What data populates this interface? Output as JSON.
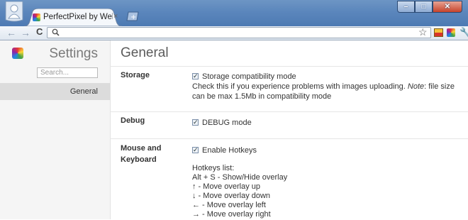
{
  "browser": {
    "tab": {
      "title": "PerfectPixel by WellDoneCode",
      "close": "×"
    },
    "window_controls": {
      "minimize": "–",
      "maximize": "□",
      "close": "✕"
    },
    "nav": {
      "back": "←",
      "forward": "→",
      "reload": "C"
    },
    "icons": {
      "profile": "profile-icon",
      "search": "search-icon",
      "star": "star-icon",
      "wrench": "wrench-icon"
    }
  },
  "sidebar": {
    "title": "Settings",
    "search_placeholder": "Search...",
    "items": [
      {
        "label": "General"
      }
    ]
  },
  "main": {
    "title": "General",
    "sections": [
      {
        "label": "Storage",
        "option": {
          "label": "Storage compatibility mode",
          "checked": true
        },
        "desc_pre": "Check this if you experience problems with images uploading. ",
        "desc_note": "Note",
        "desc_post": ": file size can be max 1.5Mb in compatibility mode"
      },
      {
        "label": "Debug",
        "option": {
          "label": "DEBUG mode",
          "checked": true
        }
      },
      {
        "label_line1": "Mouse and",
        "label_line2": "Keyboard",
        "option": {
          "label": "Enable Hotkeys",
          "checked": true
        },
        "hotkeys_title": "Hotkeys list:",
        "hotkeys": [
          "Alt + S - Show/Hide overlay",
          "↑ - Move overlay up",
          "↓ - Move overlay down",
          "← - Move overlay left",
          "→ - Move overlay right"
        ]
      }
    ]
  }
}
